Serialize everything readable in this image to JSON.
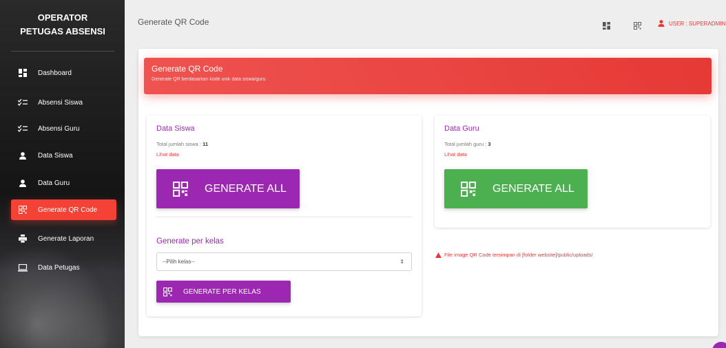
{
  "sidebar": {
    "brand_line1": "OPERATOR",
    "brand_line2": "PETUGAS ABSENSI",
    "items": [
      {
        "label": "Dashboard",
        "icon": "dashboard-icon"
      },
      {
        "label": "Absensi Siswa",
        "icon": "checklist-icon"
      },
      {
        "label": "Absensi Guru",
        "icon": "checklist-icon"
      },
      {
        "label": "Data Siswa",
        "icon": "person-icon"
      },
      {
        "label": "Data Guru",
        "icon": "person-icon"
      },
      {
        "label": "Generate QR Code",
        "icon": "qr-code-icon",
        "active": true
      },
      {
        "label": "Generate Laporan",
        "icon": "printer-icon"
      },
      {
        "label": "Data Petugas",
        "icon": "computer-icon"
      }
    ]
  },
  "topbar": {
    "title": "Generate QR Code",
    "user_label": "USER : SUPERADMIN"
  },
  "header": {
    "title": "Generate QR Code",
    "subtitle": "Generate QR berdasarkan kode unik data siswa/guru"
  },
  "siswa": {
    "title": "Data Siswa",
    "total_label": "Total jumlah siswa : ",
    "total_value": "11",
    "link": "Lihat data",
    "button": "GENERATE ALL",
    "per_kelas_title": "Generate per kelas",
    "select_value": "--Pilih kelas--",
    "per_kelas_button": "GENERATE PER KELAS"
  },
  "guru": {
    "title": "Data Guru",
    "total_label": "Total jumlah guru : ",
    "total_value": "3",
    "link": "Lihat data",
    "button": "GENERATE ALL"
  },
  "notice": "File image QR Code tersimpan di [folder website]/public/uploads/",
  "colors": {
    "accent_red": "#f44336",
    "purple": "#9c27b0",
    "green": "#4caf50"
  }
}
